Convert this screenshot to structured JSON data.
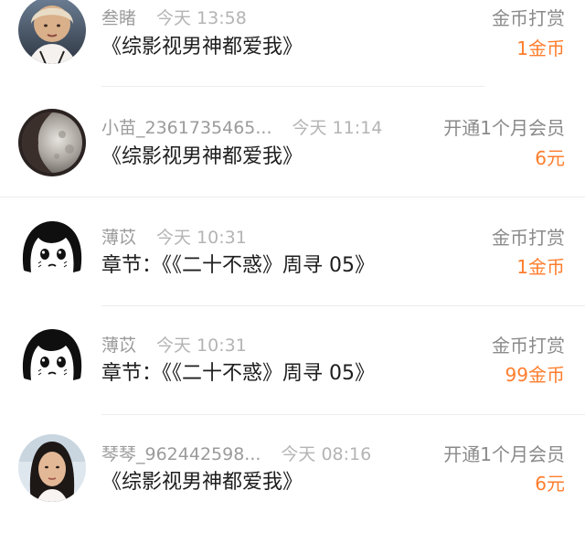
{
  "rewards": [
    {
      "name": "叁睹",
      "time": "今天 13:58",
      "title": "《综影视男神都爱我》",
      "type": "金币打赏",
      "amount": "1金币",
      "avatar_icon": "girl-photo-avatar"
    },
    {
      "name": "小苗_2361735465...",
      "time": "今天 11:14",
      "title": "《综影视男神都爱我》",
      "type": "开通1个月会员",
      "amount": "6元",
      "avatar_icon": "moon-photo-avatar"
    },
    {
      "name": "薄苡",
      "time": "今天 10:31",
      "title": "章节：《《二十不惑》周寻 05》",
      "type": "金币打赏",
      "amount": "1金币",
      "avatar_icon": "anime-girl-avatar"
    },
    {
      "name": "薄苡",
      "time": "今天 10:31",
      "title": "章节：《《二十不惑》周寻 05》",
      "type": "金币打赏",
      "amount": "99金币",
      "avatar_icon": "anime-girl-avatar"
    },
    {
      "name": "琴琴_962442598...",
      "time": "今天 08:16",
      "title": "《综影视男神都爱我》",
      "type": "开通1个月会员",
      "amount": "6元",
      "avatar_icon": "woman-photo-avatar"
    }
  ],
  "colors": {
    "amount": "#ff7d2d",
    "meta": "#a3a3a3",
    "title": "#1e1e1e",
    "divider": "#ececec"
  }
}
